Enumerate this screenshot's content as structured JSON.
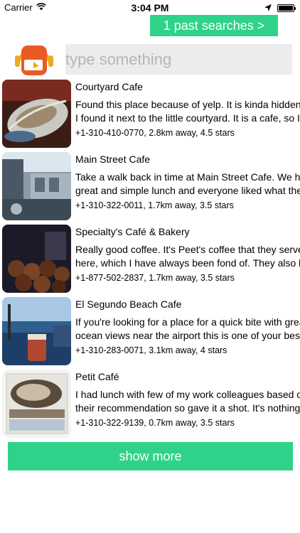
{
  "status_bar": {
    "carrier": "Carrier",
    "time": "3:04 PM",
    "icons": [
      "wifi-icon",
      "location-arrow-icon",
      "battery-icon"
    ]
  },
  "header": {
    "past_searches_label": "1 past searches >",
    "search_placeholder": "type something",
    "logo_icon": "radio-headphones-logo-icon"
  },
  "results": [
    {
      "name": "Courtyard Cafe",
      "desc_line1": "Found this place because of yelp. It is kinda hidden, b",
      "desc_line2": "I found it next to the little courtyard. It is a cafe, so I",
      "meta": "+1-310-410-0770, 2.8km away, 4.5 stars"
    },
    {
      "name": "Main Street Cafe",
      "desc_line1": "Take a walk back in time at Main Street Cafe. We hav",
      "desc_line2": "great and simple lunch and everyone liked what they",
      "meta": "+1-310-322-0011, 1.7km away, 3.5 stars"
    },
    {
      "name": "Specialty's Café & Bakery",
      "desc_line1": "Really good coffee. It's Peet's coffee that they serve",
      "desc_line2": "here, which I have always been fond of. They also h",
      "meta": "+1-877-502-2837, 1.7km away, 3.5 stars"
    },
    {
      "name": "El Segundo Beach Cafe",
      "desc_line1": "If you're looking for a place for a quick bite with grea",
      "desc_line2": "ocean views near the airport this is one of your best",
      "meta": "+1-310-283-0071, 3.1km away, 4 stars"
    },
    {
      "name": "Petit Café",
      "desc_line1": "I had lunch with few of my work colleagues based o",
      "desc_line2": "their recommendation so gave it a shot. It's nothing",
      "meta": "+1-310-322-9139, 0.7km away, 3.5 stars"
    }
  ],
  "footer": {
    "show_more_label": "show more"
  },
  "colors": {
    "accent_green": "#2ed389",
    "search_bg": "#ececec",
    "placeholder": "#b5b5b5"
  }
}
